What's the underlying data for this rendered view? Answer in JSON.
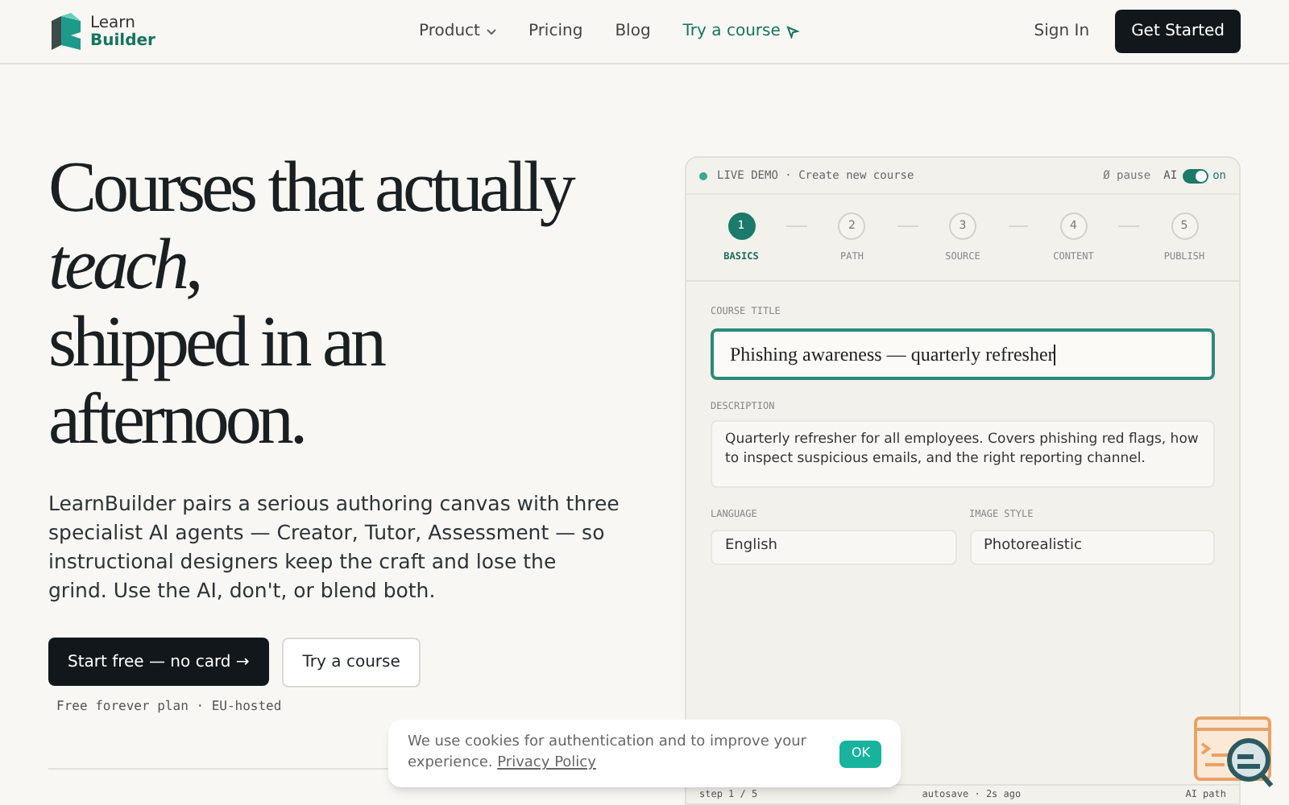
{
  "nav": {
    "brand": [
      "Learn",
      "Builder"
    ],
    "links": [
      {
        "label": "Product",
        "kind": "dropdown"
      },
      {
        "label": "Pricing",
        "kind": "plain"
      },
      {
        "label": "Blog",
        "kind": "plain"
      },
      {
        "label": "Try a course",
        "kind": "accent"
      }
    ],
    "sign_in": "Sign In",
    "cta": "Get Started"
  },
  "hero": {
    "headline": [
      "Courses that actually",
      "*teach*,",
      "shipped in an",
      "afternoon."
    ],
    "body": "LearnBuilder pairs a serious authoring canvas with three specialist AI agents — Creator, Tutor, Assessment — so instructional designers keep the craft and lose the grind. Use the AI, don't, or blend both.",
    "primary": "Start free — no card →",
    "secondary": "Try a course",
    "note": "Free forever plan · EU-hosted"
  },
  "demo": {
    "badge": "LIVE DEMO · Create new course",
    "pause": "Ø pause",
    "ai_label": "AI",
    "ai_on": true,
    "ai_state": "on",
    "steps": [
      {
        "number": "1",
        "label": "BASICS",
        "selected": true
      },
      {
        "number": "2",
        "label": "PATH",
        "selected": false
      },
      {
        "number": "3",
        "label": "SOURCE",
        "selected": false
      },
      {
        "number": "4",
        "label": "CONTENT",
        "selected": false
      },
      {
        "number": "5",
        "label": "PUBLISH",
        "selected": false
      }
    ],
    "title_label": "COURSE TITLE",
    "title_value": "Phishing awareness — quarterly refresher",
    "description_label": "DESCRIPTION",
    "description_value": "Quarterly refresher for all employees. Covers phishing red flags, how to inspect suspicious emails, and the right reporting channel.",
    "language_label": "LANGUAGE",
    "language_value": "English",
    "style_label": "IMAGE STYLE",
    "style_value": "Photorealistic",
    "footer": [
      "step 1 / 5",
      "autosave · 2s ago",
      "AI path"
    ]
  },
  "cookie": {
    "text": "We use cookies for authentication and to improve your experience.",
    "link": "Privacy Policy",
    "button": "OK"
  }
}
